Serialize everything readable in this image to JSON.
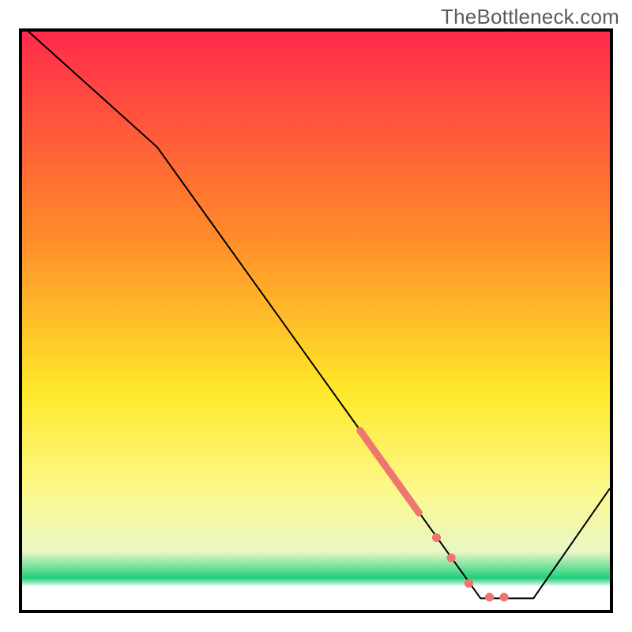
{
  "watermark": "TheBottleneck.com",
  "colors": {
    "border": "#000000",
    "watermark_text": "#5b5b5b",
    "line": "#000000",
    "marker": "#ee766e",
    "grad_top": "#ff2a4b",
    "grad_mid_upper": "#ff8a2a",
    "grad_mid": "#ffe829",
    "grad_lower_yellow": "#fbf98f",
    "grad_pale": "#e8f7c6",
    "grad_green": "#1fd079",
    "grad_bottom": "#ffffff"
  },
  "chart_data": {
    "type": "line",
    "xlim": [
      0,
      100
    ],
    "ylim": [
      0,
      100
    ],
    "xlabel": "",
    "ylabel": "",
    "title": "",
    "line_points": [
      {
        "x": 0,
        "y": 101
      },
      {
        "x": 23,
        "y": 80
      },
      {
        "x": 78,
        "y": 2
      },
      {
        "x": 87,
        "y": 2
      },
      {
        "x": 100,
        "y": 21
      }
    ],
    "marker_segment": {
      "start": {
        "x": 57.5,
        "y": 31.0
      },
      "end": {
        "x": 67.5,
        "y": 16.8
      }
    },
    "marker_dots": [
      {
        "x": 70.5,
        "y": 12.5
      },
      {
        "x": 73.0,
        "y": 9.0
      },
      {
        "x": 76.0,
        "y": 4.6
      },
      {
        "x": 79.5,
        "y": 2.2
      },
      {
        "x": 82.0,
        "y": 2.2
      }
    ],
    "gradient_stops": [
      {
        "pos": 0.0,
        "color": "#ff2a4b"
      },
      {
        "pos": 0.35,
        "color": "#ff8a2a"
      },
      {
        "pos": 0.62,
        "color": "#ffe829"
      },
      {
        "pos": 0.8,
        "color": "#fbf98f"
      },
      {
        "pos": 0.9,
        "color": "#e8f7c6"
      },
      {
        "pos": 0.945,
        "color": "#1fd079"
      },
      {
        "pos": 0.96,
        "color": "#ffffff"
      },
      {
        "pos": 1.0,
        "color": "#ffffff"
      }
    ]
  }
}
